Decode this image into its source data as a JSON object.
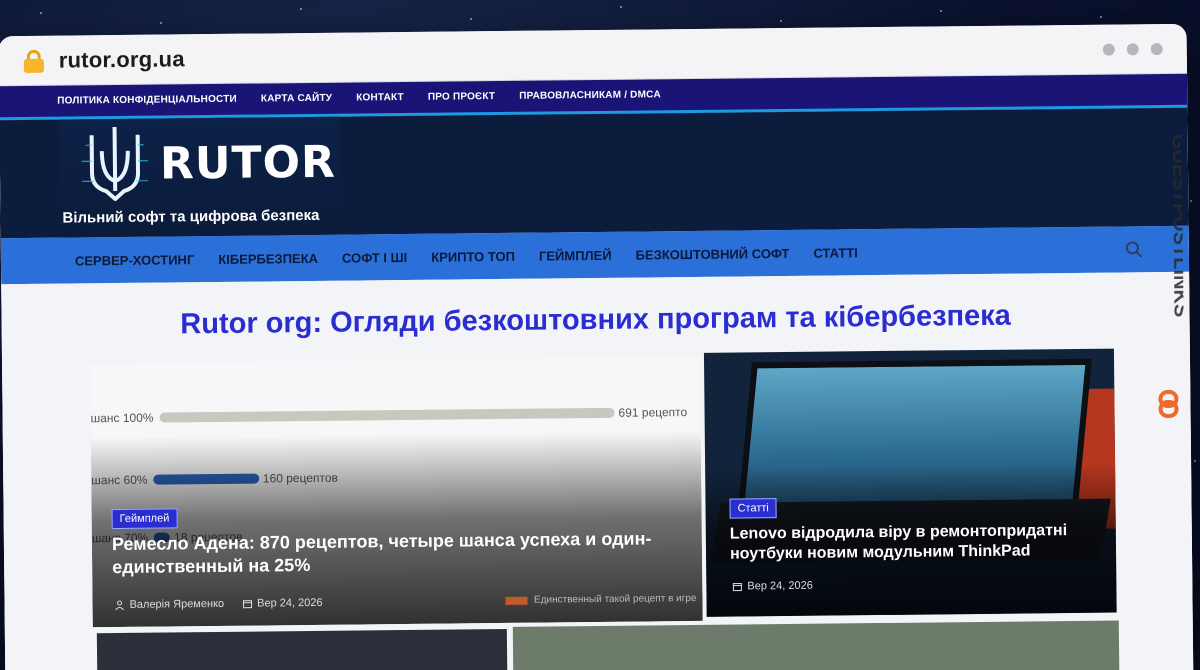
{
  "browser": {
    "url": "rutor.org.ua",
    "lock_icon": "lock-icon"
  },
  "topbar": {
    "items": [
      "ПОЛІТИКА КОНФІДЕНЦІАЛЬНОСТИ",
      "КАРТА САЙТУ",
      "КОНТАКТ",
      "ПРО ПРОЄКТ",
      "ПРАВОВЛАСНИКАМ / DMCA"
    ]
  },
  "header": {
    "logo_text": "RUTOR",
    "tagline": "Вільний софт та цифрова безпека"
  },
  "nav": {
    "items": [
      "СЕРВЕР-ХОСТИНГ",
      "КІБЕРБЕЗПЕКА",
      "СОФТ І ШІ",
      "КРИПТО ТОП",
      "ГЕЙМПЛЕЙ",
      "БЕЗКОШТОВНИЙ СОФТ",
      "СТАТТІ"
    ]
  },
  "page": {
    "title": "Rutor org: Огляди безкоштовних програм та кібербезпека"
  },
  "cards": {
    "featured": {
      "category": "Геймплей",
      "title": "Ремесло Адена: 870 рецептов, четыре шанса успеха и один-единственный на 25%",
      "author": "Валерія Яременко",
      "date": "Вер 24, 2026",
      "chart": {
        "rows": [
          {
            "label": "шанс 100%",
            "value_label": "691 рецепто",
            "value": 691,
            "color": "#c9c7c0"
          },
          {
            "label": "шанс 60%",
            "value_label": "160 рецептов",
            "value": 160,
            "color": "#2a64b9"
          },
          {
            "label": "шанс 70%",
            "value_label": "18 рецептов",
            "value": 18,
            "color": "#2a64b9"
          }
        ],
        "legend": "Единственный такой рецепт в игре"
      }
    },
    "second": {
      "category": "Статті",
      "title": "Lenovo відродила віру в ремонтопридатні ноутбуки новим модульним ThinkPad",
      "date": "Вер 24, 2026"
    }
  },
  "watermark": {
    "text": "GUESTPOSTLINKS"
  },
  "colors": {
    "topbar": "#1a1477",
    "header": "#0b1c3d",
    "nav": "#2b6fd9",
    "title": "#2a2ed1",
    "badge": "#2a2ed1"
  }
}
